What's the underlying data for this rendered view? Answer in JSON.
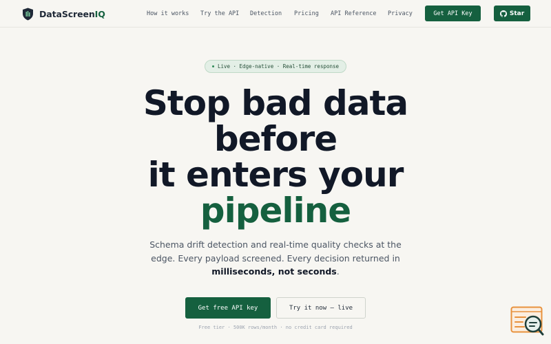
{
  "brand": {
    "name_main": "DataScreen",
    "name_accent": "IQ",
    "logo_icon": "shield-logo-icon"
  },
  "nav": {
    "items": [
      {
        "label": "How it works"
      },
      {
        "label": "Try the API"
      },
      {
        "label": "Detection"
      },
      {
        "label": "Pricing"
      },
      {
        "label": "API Reference"
      },
      {
        "label": "Privacy"
      }
    ],
    "cta_label": "Get API Key",
    "star_label": "Star",
    "star_icon": "github-icon"
  },
  "hero": {
    "badge": "Live · Edge-native · Real-time response",
    "headline_1": "Stop bad data",
    "headline_2": "before",
    "headline_3": "it enters your",
    "headline_4": "pipeline",
    "sub_1": "Schema drift detection and real-time quality checks at the",
    "sub_2": "edge. Every payload screened. Every decision returned in",
    "sub_strong": "milliseconds, not seconds",
    "sub_end": ".",
    "cta_primary": "Get free API key",
    "cta_secondary": "Try it now — live",
    "fineprint": "Free tier · 500K rows/month · no credit card required"
  },
  "widget": {
    "icon": "support-search-icon"
  },
  "colors": {
    "accent": "#15603f",
    "background": "#f7f6f2",
    "text": "#111827",
    "muted": "#4b5563",
    "widget_orange": "#e8913c"
  }
}
